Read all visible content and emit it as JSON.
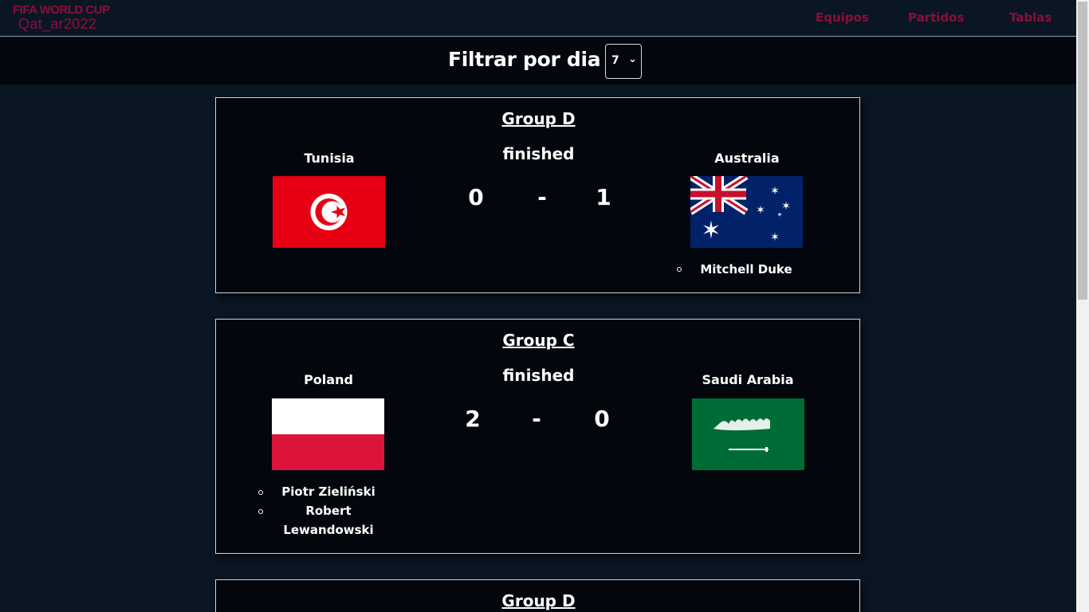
{
  "logo": {
    "line1": "FIFA WORLD CUP",
    "line2": "Qat_ar2022",
    "color": "#8b0f3a"
  },
  "nav": {
    "items": [
      "Equipos",
      "Partidos",
      "Tablas"
    ]
  },
  "filter": {
    "label": "Filtrar por dia",
    "selected_value": "7"
  },
  "matches": [
    {
      "group": "Group D",
      "status": "finished",
      "home": {
        "name": "Tunisia",
        "flag": "tunisia-flag",
        "score": "0",
        "scorers": []
      },
      "away": {
        "name": "Australia",
        "flag": "australia-flag",
        "score": "1",
        "scorers": [
          "Mitchell Duke"
        ]
      },
      "separator": "-"
    },
    {
      "group": "Group C",
      "status": "finished",
      "home": {
        "name": "Poland",
        "flag": "poland-flag",
        "score": "2",
        "scorers": [
          "Piotr Zieliński",
          "Robert",
          "Lewandowski"
        ]
      },
      "away": {
        "name": "Saudi Arabia",
        "flag": "saudi-arabia-flag",
        "score": "0",
        "scorers": []
      },
      "separator": "-"
    },
    {
      "group": "Group D"
    }
  ],
  "colors": {
    "background": "#0a1624",
    "card": "#03070d",
    "accent": "#8b0f3a"
  }
}
